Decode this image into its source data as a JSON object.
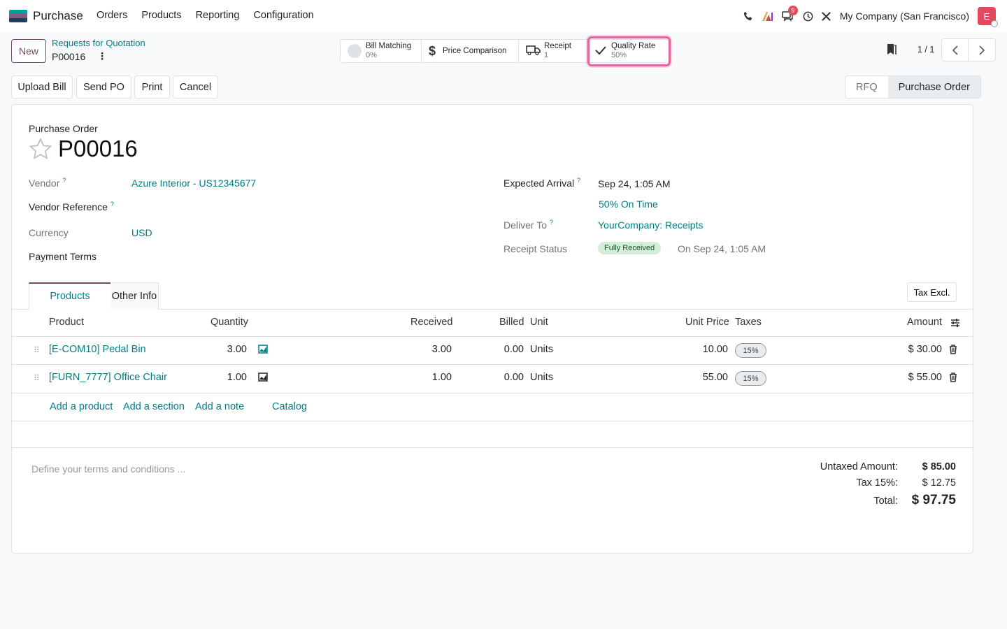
{
  "navbar": {
    "app_name": "Purchase",
    "menu": [
      "Orders",
      "Products",
      "Reporting",
      "Configuration"
    ],
    "messages_count": "9",
    "company": "My Company (San Francisco)",
    "avatar_letter": "E"
  },
  "control": {
    "new_label": "New",
    "breadcrumb_parent": "Requests for Quotation",
    "breadcrumb_current": "P00016",
    "pager": "1 / 1"
  },
  "smart_buttons": {
    "bill_matching": {
      "title": "Bill Matching",
      "value": "0%"
    },
    "price_comparison": {
      "title": "Price Comparison"
    },
    "receipt": {
      "title": "Receipt",
      "value": "1"
    },
    "quality_rate": {
      "title": "Quality Rate",
      "value": "50%"
    }
  },
  "actions": {
    "upload_bill": "Upload Bill",
    "send_po": "Send PO",
    "print": "Print",
    "cancel": "Cancel"
  },
  "stages": {
    "rfq": "RFQ",
    "purchase_order": "Purchase Order"
  },
  "form": {
    "doc_type": "Purchase Order",
    "doc_name": "P00016",
    "vendor_label": "Vendor",
    "vendor_value": "Azure Interior - US12345677",
    "vendor_ref_label": "Vendor Reference",
    "currency_label": "Currency",
    "currency_value": "USD",
    "payment_terms_label": "Payment Terms",
    "expected_arrival_label": "Expected Arrival",
    "expected_arrival_value": "Sep 24, 1:05 AM",
    "on_time": "50% On Time",
    "deliver_to_label": "Deliver To",
    "deliver_to_value": "YourCompany: Receipts",
    "receipt_status_label": "Receipt Status",
    "receipt_status_value": "Fully Received",
    "receipt_status_date": "On Sep 24, 1:05 AM",
    "help": "?"
  },
  "tabs": {
    "products": "Products",
    "other_info": "Other Info"
  },
  "tax_toggle": "Tax Excl.",
  "table": {
    "headers": {
      "product": "Product",
      "quantity": "Quantity",
      "received": "Received",
      "billed": "Billed",
      "unit": "Unit",
      "unit_price": "Unit Price",
      "taxes": "Taxes",
      "amount": "Amount"
    },
    "rows": [
      {
        "product": "[E-COM10] Pedal Bin",
        "quantity": "3.00",
        "received": "3.00",
        "billed": "0.00",
        "unit": "Units",
        "unit_price": "10.00",
        "taxes": "15%",
        "amount": "$ 30.00"
      },
      {
        "product": "[FURN_7777] Office Chair",
        "quantity": "1.00",
        "received": "1.00",
        "billed": "0.00",
        "unit": "Units",
        "unit_price": "55.00",
        "taxes": "15%",
        "amount": "$ 55.00"
      }
    ],
    "add_product": "Add a product",
    "add_section": "Add a section",
    "add_note": "Add a note",
    "catalog": "Catalog"
  },
  "terms_placeholder": "Define your terms and conditions ...",
  "totals": {
    "untaxed_label": "Untaxed Amount:",
    "untaxed_value": "$ 85.00",
    "tax_label": "Tax 15%:",
    "tax_value": "$ 12.75",
    "total_label": "Total:",
    "total_value": "$ 97.75"
  },
  "colors": {
    "brand": "#714b67",
    "link": "#017e84",
    "highlight": "#e0679d"
  }
}
